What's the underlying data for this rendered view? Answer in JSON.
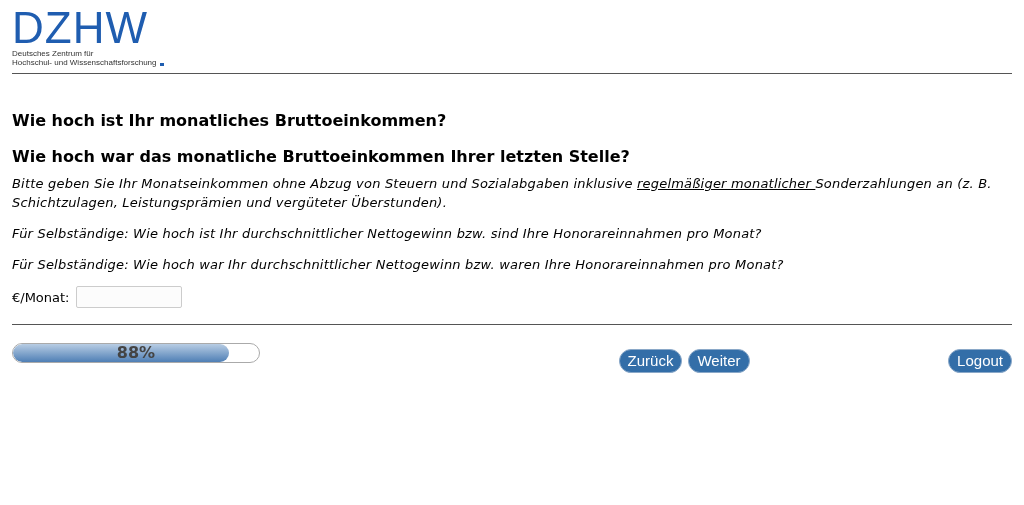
{
  "logo": {
    "wordmark": "DZHW",
    "subtitle_lines": [
      "Deutsches Zentrum für",
      "Hochschul- und Wissenschaftsforschung"
    ]
  },
  "questions": [
    "Wie hoch ist Ihr monatliches Bruttoeinkommen?",
    "Wie hoch war das monatliche Bruttoeinkommen Ihrer letzten Stelle?"
  ],
  "instruction": {
    "before": "Bitte geben Sie Ihr Monatseinkommen ohne Abzug von Steuern und Sozialabgaben inklusive ",
    "link": "regelmäßiger monatlicher ",
    "after": "Sonderzahlungen an (z. B. Schichtzulagen, Leistungsprämien und vergüteter Überstunden)."
  },
  "notes": [
    "Für Selbständige: Wie hoch ist Ihr durchschnittlicher Nettogewinn bzw. sind Ihre Honorareinnahmen pro Monat?",
    "Für Selbständige: Wie hoch war Ihr durchschnittlicher Nettogewinn bzw. waren Ihre Honorareinnahmen pro Monat?"
  ],
  "field": {
    "label": "€/Monat:"
  },
  "progress": {
    "level": 0.88,
    "reading": "88%"
  },
  "nav_buttons": [
    "Zurück",
    "Weiter"
  ],
  "logout_button": "Logout"
}
